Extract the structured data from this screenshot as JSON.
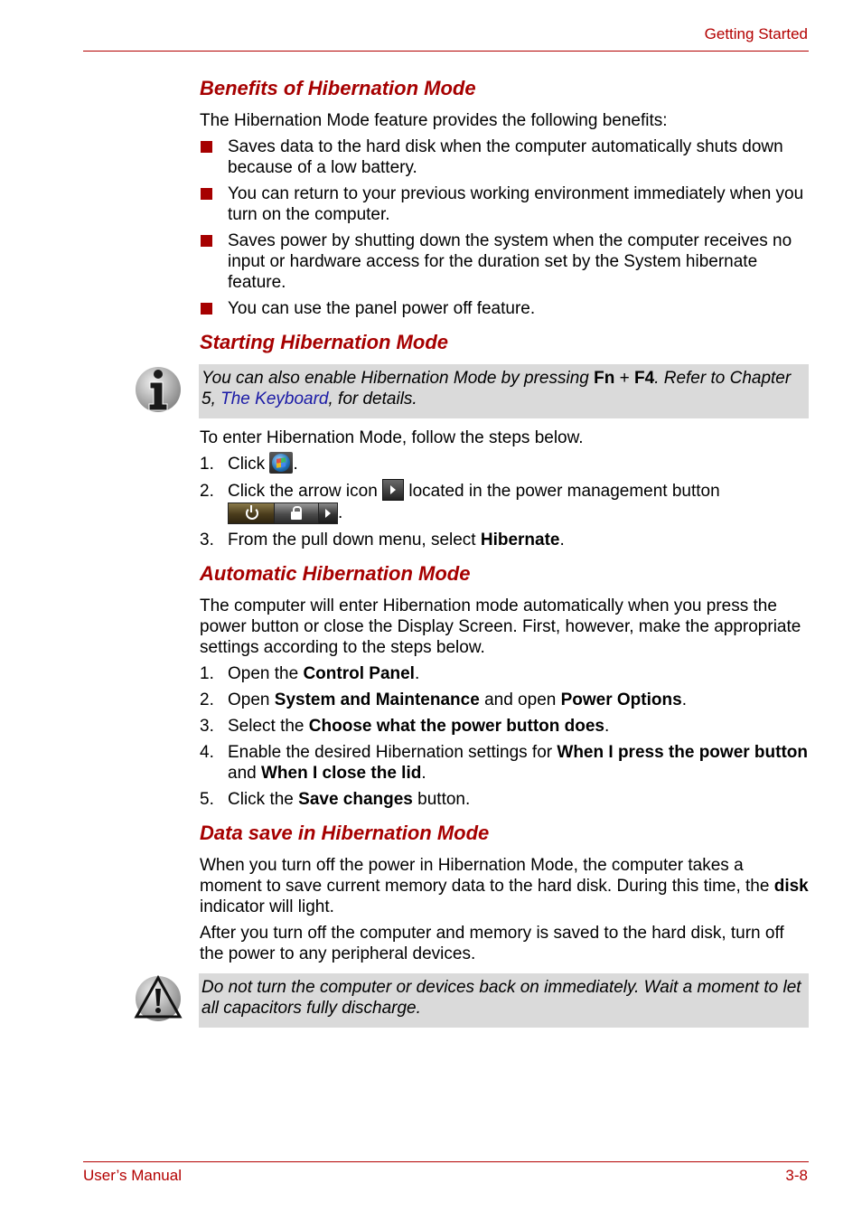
{
  "header": {
    "chapter_title": "Getting Started"
  },
  "footer": {
    "manual_title": "User’s Manual",
    "page_number": "3-8"
  },
  "sections": {
    "benefits": {
      "heading": "Benefits of Hibernation Mode",
      "intro": "The Hibernation Mode feature provides the following benefits:",
      "bullets": [
        "Saves data to the hard disk when the computer automatically shuts down because of a low battery.",
        "You can return to your previous working environment immediately when you turn on the computer.",
        "Saves power by shutting down the system when the computer receives no input or hardware access for the duration set by the System hibernate feature.",
        "You can use the panel power off feature."
      ]
    },
    "starting": {
      "heading": "Starting Hibernation Mode",
      "note": {
        "icon": "info-icon",
        "text1": "You can also enable Hibernation Mode by pressing ",
        "key1": "Fn",
        "plus": " + ",
        "key2": "F4",
        "text2": ". Refer to Chapter 5, ",
        "link": "The Keyboard",
        "text3": ", for details."
      },
      "intro": "To enter Hibernation Mode, follow the steps below.",
      "steps": [
        {
          "num": "1.",
          "text": "Click ",
          "icon": "windows-start-orb-icon",
          "tail": "."
        },
        {
          "num": "2.",
          "text": "Click the arrow icon ",
          "icon": "arrow-right-icon",
          "mid": " located in the power management button",
          "icon2": "power-management-button-icon",
          "tail": "."
        },
        {
          "num": "3.",
          "text": "From the pull down menu, select ",
          "bold": "Hibernate",
          "tail": "."
        }
      ]
    },
    "automatic": {
      "heading": "Automatic Hibernation Mode",
      "intro": "The computer will enter Hibernation mode automatically when you press the power button or close the Display Screen. First, however, make the appropriate settings according to the steps below.",
      "steps": [
        {
          "num": "1.",
          "t1": "Open the ",
          "b1": "Control Panel",
          "t2": "."
        },
        {
          "num": "2.",
          "t1": "Open ",
          "b1": "System and Maintenance",
          "t2": " and open ",
          "b2": "Power Options",
          "t3": "."
        },
        {
          "num": "3.",
          "t1": "Select the ",
          "b1": "Choose what the power button does",
          "t2": "."
        },
        {
          "num": "4.",
          "t1": "Enable the desired Hibernation settings for ",
          "b1": "When I press the power button",
          "t2": " and ",
          "b2": "When I close the lid",
          "t3": "."
        },
        {
          "num": "5.",
          "t1": "Click the ",
          "b1": "Save changes",
          "t2": " button."
        }
      ]
    },
    "datasave": {
      "heading": "Data save in Hibernation Mode",
      "para1_a": "When you turn off the power in Hibernation Mode, the computer takes a moment to save current memory data to the hard disk. During this time, the ",
      "para1_bold": "disk",
      "para1_b": " indicator will light.",
      "para2": "After you turn off the computer and memory is saved to the hard disk, turn off the power to any peripheral devices.",
      "caution": {
        "icon": "warning-icon",
        "text": "Do not turn the computer or devices back on immediately. Wait a moment to let all capacitors fully discharge."
      }
    }
  },
  "colors": {
    "accent": "#a60000",
    "note_bg": "#dadada",
    "link": "#1a1aa6"
  }
}
